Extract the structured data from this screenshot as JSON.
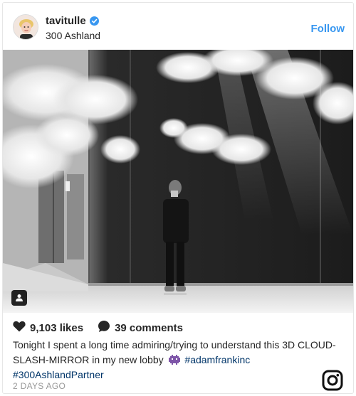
{
  "post": {
    "username": "tavitulle",
    "location": "300 Ashland",
    "follow_label": "Follow",
    "likes": "9,103 likes",
    "comments": "39 comments",
    "caption_text": "Tonight I spent a long time admiring/trying to understand this 3D CLOUD-SLASH-MIRROR in my new lobby",
    "hashtag_1": "#adamfrankinc",
    "hashtag_2": "#300AshlandPartner",
    "timestamp": "2 DAYS AGO"
  },
  "icons": {
    "verified": "verified-badge-icon",
    "tag": "user-tag-icon",
    "like": "heart-icon",
    "comment": "comment-bubble-icon",
    "emoji": "alien-monster-emoji",
    "logo": "instagram-logo-icon"
  },
  "colors": {
    "accent": "#3897f0",
    "hashtag": "#003569",
    "text": "#262626",
    "muted": "#999999"
  }
}
